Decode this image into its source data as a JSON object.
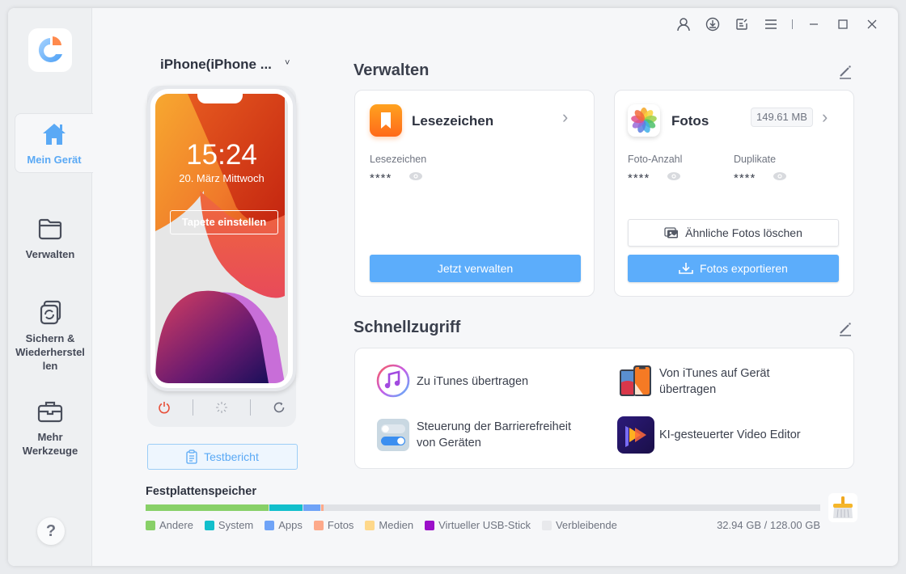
{
  "sidebar": {
    "logo_icon": "app-logo",
    "items": [
      {
        "label": "Mein Gerät",
        "icon": "home-icon",
        "active": true
      },
      {
        "label": "Verwalten",
        "icon": "folder-icon",
        "active": false
      },
      {
        "label": "Sichern & Wiederherstel len",
        "icon": "backup-restore-icon",
        "active": false
      },
      {
        "label": "Mehr Werkzeuge",
        "icon": "toolbox-icon",
        "active": false
      }
    ],
    "help_label": "?"
  },
  "topbar": {
    "icons": [
      "user-icon",
      "download-icon",
      "feedback-icon",
      "menu-icon",
      "minimize-icon",
      "maximize-icon",
      "close-icon"
    ]
  },
  "device": {
    "name": "iPhone(iPhone ...",
    "caret": "˅",
    "time": "15:24",
    "date": "20. März Mittwoch",
    "wallpaper_button": "Tapete einstellen",
    "controls": [
      "power-icon",
      "loading-icon",
      "refresh-icon"
    ],
    "report_button": "Testbericht"
  },
  "manage": {
    "title": "Verwalten",
    "bookmarks": {
      "title": "Lesezeichen",
      "stat_label": "Lesezeichen",
      "stat_value": "****",
      "button": "Jetzt verwalten"
    },
    "photos": {
      "title": "Fotos",
      "size": "149.61 MB",
      "count_label": "Foto-Anzahl",
      "count_value": "****",
      "dup_label": "Duplikate",
      "dup_value": "****",
      "similar_button": "Ähnliche Fotos löschen",
      "export_button": "Fotos exportieren"
    }
  },
  "quick": {
    "title": "Schnellzugriff",
    "items": [
      {
        "label": "Zu iTunes übertragen",
        "icon": "itunes-icon"
      },
      {
        "label": "Von iTunes auf Gerät übertragen",
        "icon": "phone-transfer-icon"
      },
      {
        "label": "Steuerung der Barrierefreiheit von Geräten",
        "icon": "toggle-icon"
      },
      {
        "label": "KI-gesteuerter Video Editor",
        "icon": "video-editor-icon"
      }
    ]
  },
  "storage": {
    "title": "Festplattenspeicher",
    "used": "32.94 GB / 128.00 GB",
    "segments": [
      {
        "name": "Andere",
        "color": "#88d068",
        "percent": 18.2
      },
      {
        "name": "System",
        "color": "#12bfcc",
        "percent": 4.9
      },
      {
        "name": "Apps",
        "color": "#6fa3f7",
        "percent": 2.6
      },
      {
        "name": "Fotos",
        "color": "#fda98a",
        "percent": 0.3
      },
      {
        "name": "Medien",
        "color": "#fed88a",
        "percent": 0.0
      },
      {
        "name": "Virtueller USB-Stick",
        "color": "#9b0fc9",
        "percent": 0.0
      },
      {
        "name": "Verbleibende",
        "color": "#e8e9ec",
        "percent": 74.0
      }
    ]
  },
  "colors": {
    "accent": "#5cadfb",
    "active_nav": "#5aa9f5",
    "power": "#e8503a"
  }
}
